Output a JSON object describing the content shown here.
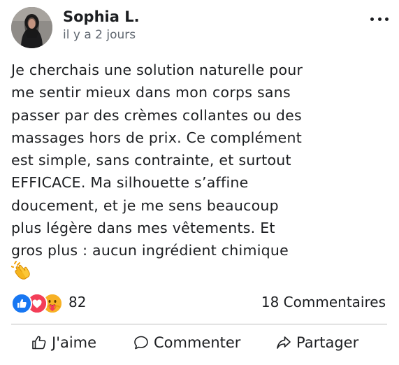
{
  "post": {
    "author_name": "Sophia L.",
    "time": "il y a 2 jours",
    "text": "Je cherchais une solution naturelle pour\nme sentir mieux dans mon corps sans\npasser par des crèmes collantes ou des\nmassages hors de prix. Ce complément\nest simple, sans contrainte, et surtout\nEFFICACE. Ma silhouette s’affine\ndoucement, et je me sens beaucoup\nplus légère dans mes vêtements. Et\ngros plus : aucun ingrédient chimique",
    "trailing_emoji": "clapping-hands"
  },
  "stats": {
    "reaction_count": "82",
    "comments_label": "18 Commentaires",
    "reactions": [
      "like",
      "love",
      "care"
    ]
  },
  "actions": {
    "like_label": "J'aime",
    "comment_label": "Commenter",
    "share_label": "Partager"
  },
  "colors": {
    "like_blue": "#1877f2",
    "love_red": "#f33e58",
    "care_yellow": "#f7b125",
    "text": "#1c1e21",
    "muted": "#606770",
    "divider": "#bdbdbd"
  }
}
